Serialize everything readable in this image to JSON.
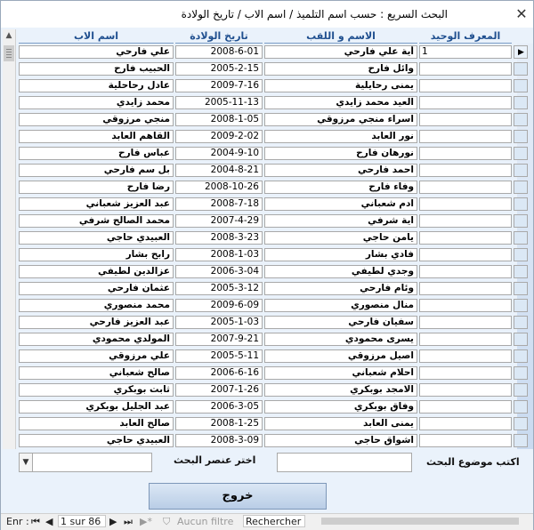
{
  "window": {
    "title": "البحث السريع : حسب اسم التلميذ / اسم الاب / تاريخ الولادة",
    "close_glyph": "✕"
  },
  "columns": {
    "father": "اسم الاب",
    "birth": "تاريخ الولادة",
    "name": "الاسم و اللقب",
    "id": "المعرف الوحيد"
  },
  "current_id": "1",
  "rows": [
    {
      "father": "علي فارحي",
      "birth": "2008-6-01",
      "name": "أية علي فارحي"
    },
    {
      "father": "الحبيب فارح",
      "birth": "2005-2-15",
      "name": "وائل فارح"
    },
    {
      "father": "عادل رحاحلية",
      "birth": "2009-7-16",
      "name": "يمنى رحايلية"
    },
    {
      "father": "محمد زايدي",
      "birth": "2005-11-13",
      "name": "العيد محمد زايدي"
    },
    {
      "father": "منجي مرزوقي",
      "birth": "2008-1-05",
      "name": "اسراء منجي مرزوقي"
    },
    {
      "father": "القاهم العابد",
      "birth": "2009-2-02",
      "name": "نور العابد"
    },
    {
      "father": "عباس فارح",
      "birth": "2004-9-10",
      "name": "نورهان فارح"
    },
    {
      "father": "بل سم فارحي",
      "birth": "2004-8-21",
      "name": "احمد فارحي"
    },
    {
      "father": "رضا فارح",
      "birth": "2008-10-26",
      "name": "وفاء فارح"
    },
    {
      "father": "عبد العزيز شعباني",
      "birth": "2008-7-18",
      "name": "ادم شعباني"
    },
    {
      "father": "محمد الصالح شرفي",
      "birth": "2007-4-29",
      "name": "اية شرفي"
    },
    {
      "father": "العبيدي حاجي",
      "birth": "2008-3-23",
      "name": "يامن حاجي"
    },
    {
      "father": "رابح بشار",
      "birth": "2008-1-03",
      "name": "فادي بشار"
    },
    {
      "father": "عزالدين لطيفي",
      "birth": "2006-3-04",
      "name": "وجدي لطيفي"
    },
    {
      "father": "عثمان فارحي",
      "birth": "2005-3-12",
      "name": "وئام فارحي"
    },
    {
      "father": "محمد منصوري",
      "birth": "2009-6-09",
      "name": "منال منصوري"
    },
    {
      "father": "عبد العزيز فارحي",
      "birth": "2005-1-03",
      "name": "سفيان فارحي"
    },
    {
      "father": "المولدي محمودي",
      "birth": "2007-9-21",
      "name": "يسرى محمودي"
    },
    {
      "father": "علي مرزوقي",
      "birth": "2005-5-11",
      "name": "اصيل مرزوقي"
    },
    {
      "father": "صالح شعباني",
      "birth": "2006-6-16",
      "name": "احلام شعباني"
    },
    {
      "father": "ثابت بوبكري",
      "birth": "2007-1-26",
      "name": "الامجد بوبكري"
    },
    {
      "father": "عبد الجليل بوبكري",
      "birth": "2006-3-05",
      "name": "وفاق بوبكري"
    },
    {
      "father": "صالح العابد",
      "birth": "2008-1-25",
      "name": "يمنى العابد"
    },
    {
      "father": "العبيدي حاجي",
      "birth": "2008-3-09",
      "name": "اشواق حاجي"
    }
  ],
  "search": {
    "topic_label": "اكتب موضوع البحث",
    "element_label": "اختر عنصر البحث",
    "topic_value": "",
    "element_value": ""
  },
  "exit_button": "خروج",
  "status": {
    "record_label": "Enr :",
    "record_value": "1 sur 86",
    "filter_label": "Aucun filtre",
    "search_placeholder": "Rechercher"
  }
}
